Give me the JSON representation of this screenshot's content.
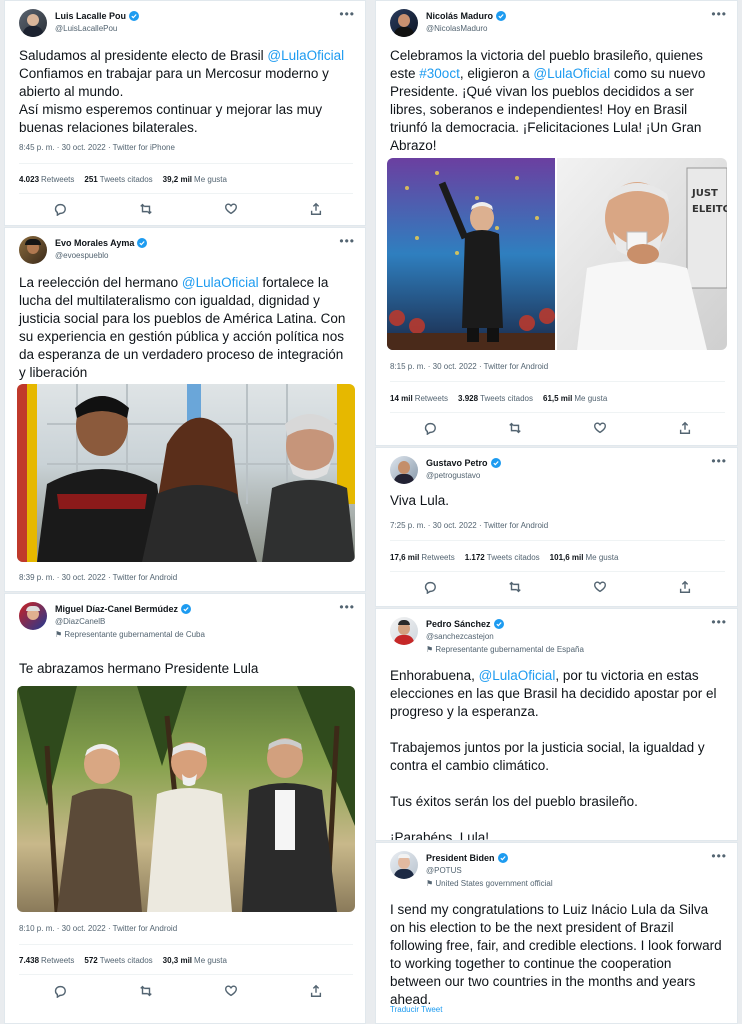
{
  "icons": {
    "more": "more-icon",
    "reply": "reply-icon",
    "retweet": "retweet-icon",
    "like": "like-icon",
    "share": "share-icon",
    "verified": "verified-badge-icon",
    "gov": "government-flag-icon"
  },
  "colors": {
    "link": "#1d9bf0",
    "verified": "#1d9bf0",
    "text": "#0f1419",
    "muted": "#536471"
  },
  "tweets": [
    {
      "name": "Luis Lacalle Pou",
      "handle": "@LuisLacallePou",
      "text": "Saludamos al presidente electo de Brasil ",
      "mention": "@LulaOficial",
      "text2": "Confiamos en trabajar para un Mercosur moderno y abierto al mundo.",
      "text3": "Así mismo esperemos continuar y mejorar las muy buenas relaciones bilaterales.",
      "meta": "8:45 p. m. · 30 oct. 2022 · Twitter for iPhone",
      "retweets": "4.023",
      "retweets_label": "Retweets",
      "quotes": "251",
      "quotes_label": "Tweets citados",
      "likes": "39,2 mil",
      "likes_label": "Me gusta"
    },
    {
      "name": "Evo Morales Ayma",
      "handle": "@evoespueblo",
      "text": "La reelección del hermano ",
      "mention": "@LulaOficial",
      "text2": " fortalece la lucha del multilateralismo con igualdad, dignidad y justicia social para los pueblos de América Latina. Con su experiencia en gestión pública y acción política nos da esperanza de un verdadero proceso de integración y liberación",
      "meta": "8:39 p. m. · 30 oct. 2022 · Twitter for Android"
    },
    {
      "name": "Miguel Díaz-Canel Bermúdez",
      "handle": "@DiazCanelB",
      "gov": "Representante gubernamental de Cuba",
      "text": "Te abrazamos hermano Presidente Lula",
      "meta": "8:10 p. m. · 30 oct. 2022 · Twitter for Android",
      "retweets": "7.438",
      "retweets_label": "Retweets",
      "quotes": "572",
      "quotes_label": "Tweets citados",
      "likes": "30,3 mil",
      "likes_label": "Me gusta"
    },
    {
      "name": "Nicolás Maduro",
      "handle": "@NicolasMaduro",
      "text": "Celebramos la victoria del pueblo brasileño, quienes este ",
      "hashtag": "#30oct",
      "text2": ", eligieron a ",
      "mention": "@LulaOficial",
      "text3": " como su nuevo Presidente. ¡Qué vivan los pueblos decididos a ser libres, soberanos e independientes! Hoy en Brasil triunfó la democracia. ¡Felicitaciones Lula! ¡Un Gran Abrazo!",
      "meta": "8:15 p. m. · 30 oct. 2022 · Twitter for Android",
      "retweets": "14 mil",
      "retweets_label": "Retweets",
      "quotes": "3.928",
      "quotes_label": "Tweets citados",
      "likes": "61,5 mil",
      "likes_label": "Me gusta"
    },
    {
      "name": "Gustavo Petro",
      "handle": "@petrogustavo",
      "text": "Viva Lula.",
      "meta": "7:25 p. m. · 30 oct. 2022 · Twitter for Android",
      "retweets": "17,6 mil",
      "retweets_label": "Retweets",
      "quotes": "1.172",
      "quotes_label": "Tweets citados",
      "likes": "101,6 mil",
      "likes_label": "Me gusta"
    },
    {
      "name": "Pedro Sánchez",
      "handle": "@sanchezcastejon",
      "gov": "Representante gubernamental de España",
      "text": "Enhorabuena, ",
      "mention": "@LulaOficial",
      "text2": ", por tu victoria en estas elecciones en las que Brasil ha decidido apostar por el progreso y la esperanza.",
      "p2": "Trabajemos juntos por la justicia social, la igualdad y contra el cambio climático.",
      "p3": "Tus éxitos serán los del pueblo brasileño.",
      "p4": "¡Parabéns, Lula!"
    },
    {
      "name": "President Biden",
      "handle": "@POTUS",
      "gov": "United States government official",
      "text": "I send my congratulations to Luiz Inácio Lula da Silva on his election to be the next president of Brazil following free, fair, and credible elections. I look forward to working together to continue the cooperation between our two countries in the months and years ahead.",
      "translate": "Traducir Tweet"
    }
  ]
}
